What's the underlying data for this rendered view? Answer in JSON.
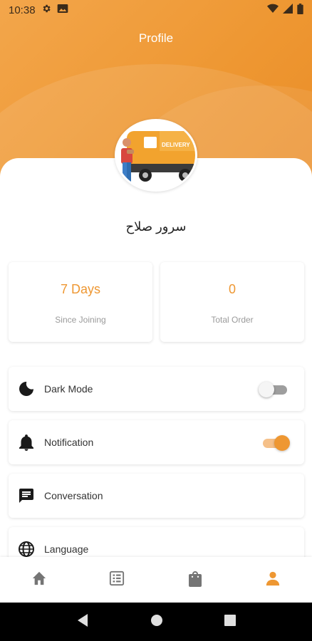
{
  "status_bar": {
    "time": "10:38"
  },
  "header": {
    "title": "Profile"
  },
  "avatar": {
    "van_text": "DELIVERY"
  },
  "user": {
    "name": "سرور صلاح"
  },
  "stats": [
    {
      "value": "7 Days",
      "label": "Since Joining"
    },
    {
      "value": "0",
      "label": "Total Order"
    }
  ],
  "menu": [
    {
      "label": "Dark Mode",
      "icon": "moon-icon",
      "toggle": "off"
    },
    {
      "label": "Notification",
      "icon": "bell-icon",
      "toggle": "on"
    },
    {
      "label": "Conversation",
      "icon": "chat-icon"
    },
    {
      "label": "Language",
      "icon": "globe-icon"
    }
  ],
  "bottom_nav": {
    "items": [
      "home-icon",
      "orders-list-icon",
      "shopping-bag-icon",
      "person-icon"
    ],
    "active": "person-icon"
  },
  "colors": {
    "accent": "#ee9732",
    "inactive_icon": "#757575"
  }
}
